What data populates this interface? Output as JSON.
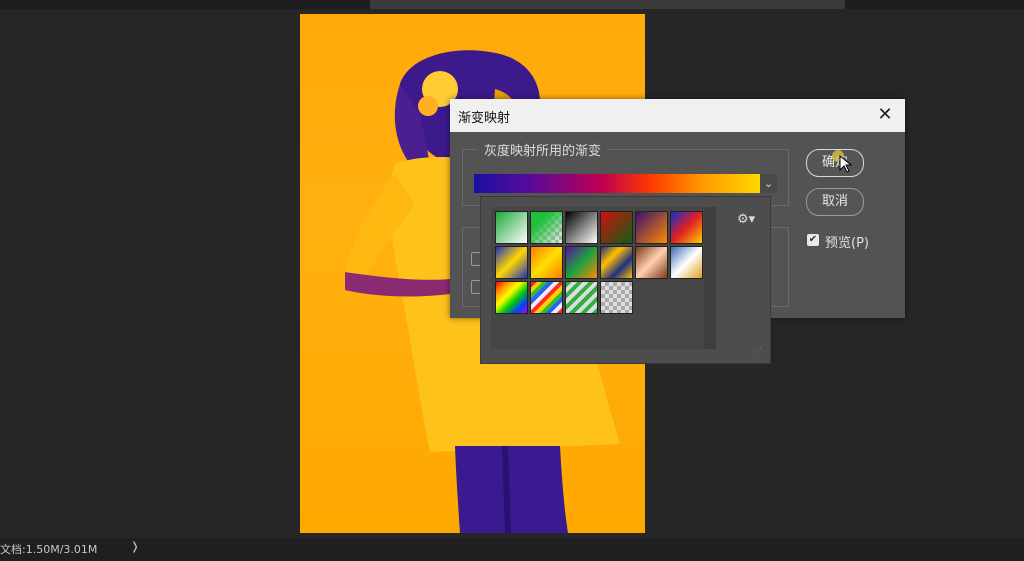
{
  "status_bar": {
    "doc_info": "文档:1.50M/3.01M",
    "arrow": "❭"
  },
  "dialog": {
    "title": "渐变映射",
    "close_glyph": "✕",
    "group_label": "灰度映射所用的渐变",
    "ok_label": "确定",
    "cancel_label": "取消",
    "preview_label": "预览(P)",
    "preview_checked": true,
    "preview_check_glyph": "✔",
    "dropdown_glyph": "⌄"
  },
  "picker": {
    "gear_glyph": "⚙▾",
    "grip_glyph": "⋰",
    "swatches": [
      "green-white",
      "green-transparent",
      "black-white",
      "red-green",
      "violet-orange",
      "blue-red-yellow",
      "blue-yellow-blue",
      "orange-yellow-orange",
      "violet-green-orange",
      "steel-bar",
      "copper",
      "chrome",
      "spectrum",
      "transparent-rainbow",
      "transparent-stripes",
      "transparent-checker"
    ]
  },
  "colors": {
    "canvas_orange": "#ffa90a",
    "figure_purple": "#3c1a8c",
    "dialog_bg": "#535353"
  }
}
